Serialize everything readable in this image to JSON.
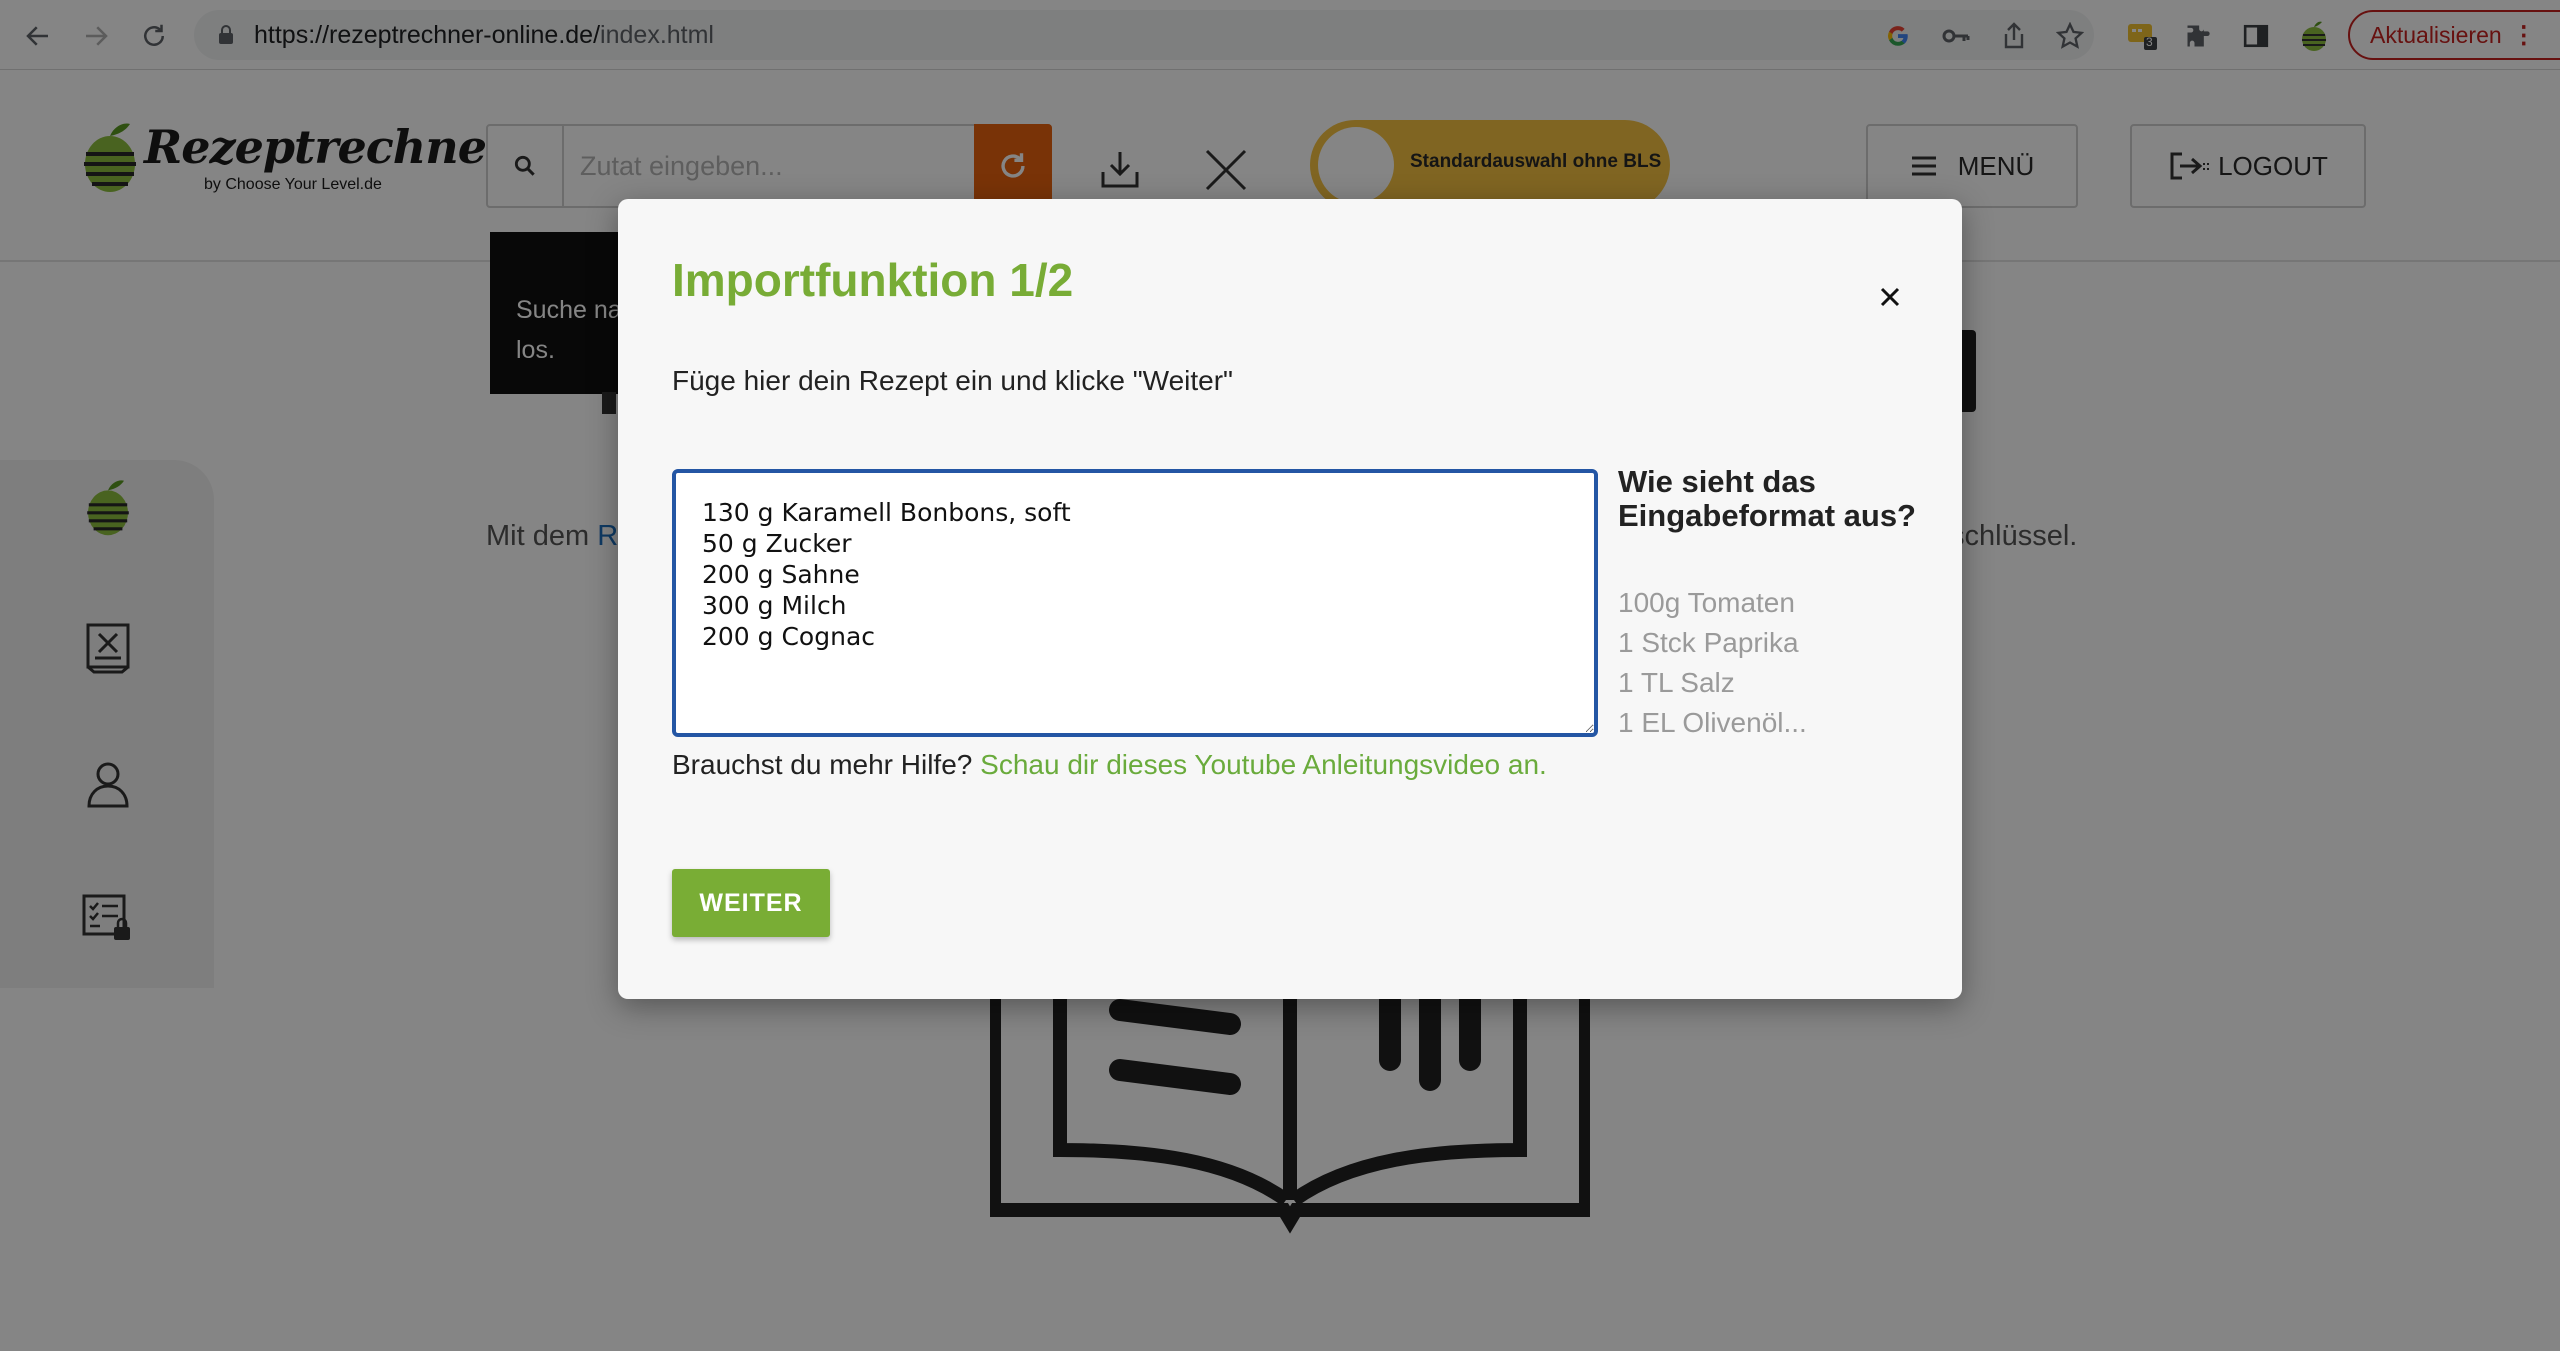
{
  "browser": {
    "url_main": "https://rezeptrechner-online.de/",
    "url_path": "index.html",
    "extension_badge": "3",
    "update_label": "Aktualisieren"
  },
  "header": {
    "logo_text": "Rezeptrechner",
    "logo_sub": "by Choose Your Level.de",
    "search_placeholder": "Zutat eingeben...",
    "toggle_label": "Standardauswahl ohne BLS",
    "menu_label": "MENÜ",
    "logout_label": "LOGOUT"
  },
  "background": {
    "tooltip_text_1": "Suche na",
    "tooltip_text_2": "los.",
    "intro_start": "Mit dem ",
    "intro_link": "R",
    "intro_end": "schlüssel."
  },
  "modal": {
    "title": "Importfunktion 1/2",
    "instruction": "Füge hier dein Rezept ein und klicke \"Weiter\"",
    "recipe_text": "130 g Karamell Bonbons, soft\n50 g Zucker\n200 g Sahne\n300 g Milch\n200 g Cognac",
    "format_heading": "Wie sieht das Eingabeformat aus?",
    "format_examples": [
      "100g Tomaten",
      "1 Stck Paprika",
      "1 TL Salz",
      "1 EL Olivenöl..."
    ],
    "help_prefix": "Brauchst du mehr Hilfe? ",
    "help_link": "Schau dir dieses Youtube Anleitungsvideo an.",
    "continue_label": "WEITER"
  },
  "colors": {
    "accent_green": "#78ac36",
    "search_orange": "#e8620f",
    "toggle_yellow": "#f5c242",
    "textarea_border": "#2456a4"
  },
  "icons": [
    "back-arrow-icon",
    "forward-arrow-icon",
    "reload-icon",
    "lock-icon",
    "google-icon",
    "key-icon",
    "share-icon",
    "star-icon",
    "extension-icon",
    "puzzle-icon",
    "sidepanel-icon",
    "apple-icon",
    "kebab-icon",
    "search-icon",
    "refresh-icon",
    "download-icon",
    "close-icon",
    "hamburger-icon",
    "logout-icon",
    "recipe-icon",
    "user-icon",
    "checklist-lock-icon",
    "book-icon"
  ]
}
